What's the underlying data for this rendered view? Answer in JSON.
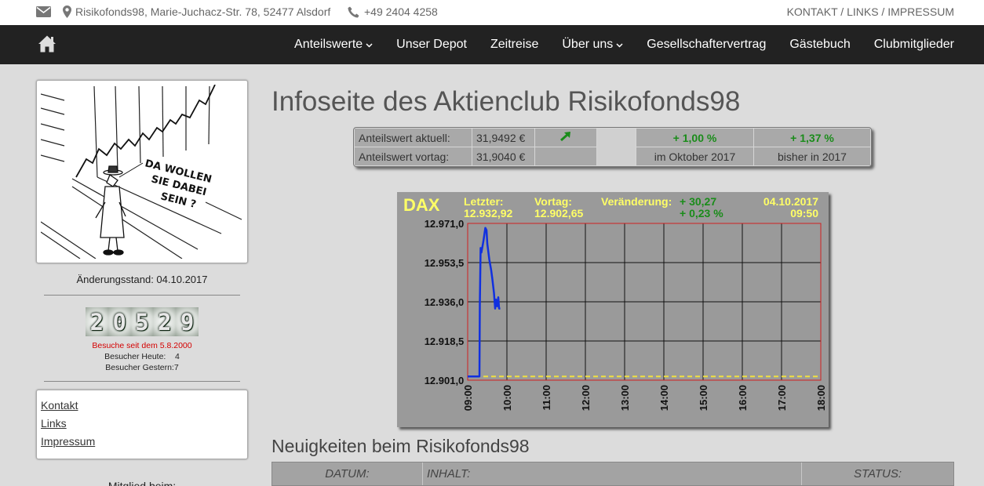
{
  "topbar": {
    "address": "Risikofonds98, Marie-Juchacz-Str. 78, 52477 Alsdorf",
    "phone": "+49 2404 4258",
    "links": "KONTAKT / LINKS / IMPRESSUM"
  },
  "nav": {
    "items": [
      {
        "label": "Anteilswerte",
        "dropdown": true
      },
      {
        "label": "Unser Depot"
      },
      {
        "label": "Zeitreise"
      },
      {
        "label": "Über uns",
        "dropdown": true
      },
      {
        "label": "Gesellschaftervertrag"
      },
      {
        "label": "Gästebuch"
      },
      {
        "label": "Clubmitglieder"
      }
    ]
  },
  "sidebar": {
    "cartoon_text": [
      "DA WOLLEN",
      "SIE DABEI",
      "SEIN ?"
    ],
    "update_label": "Änderungsstand: 04.10.2017",
    "counter_digits": [
      "2",
      "0",
      "5",
      "2",
      "9"
    ],
    "visits_since": "Besuche seit dem 5.8.2000",
    "visitors_today": "Besucher Heute:    4",
    "visitors_yesterday": "Besucher Gestern:7",
    "links": [
      "Kontakt",
      "Links",
      "Impressum"
    ],
    "member_label": "Mitglied beim:"
  },
  "main": {
    "title": "Infoseite des Aktienclub Risikofonds98",
    "quote": {
      "current_label": "Anteilswert aktuell:",
      "current_value": "31,9492 €",
      "previous_label": "Anteilswert vortag:",
      "previous_value": "31,9040 €",
      "month_change": "+ 1,00 %",
      "month_label": "im Oktober 2017",
      "year_change": "+ 1,37 %",
      "year_label": "bisher in 2017",
      "trend_icon": "arrow-up-right-icon"
    },
    "news": {
      "title": "Neuigkeiten beim Risikofonds98",
      "headers": [
        "DATUM:",
        "INHALT:",
        "STATUS:"
      ]
    }
  },
  "chart_data": {
    "type": "line",
    "title": "DAX",
    "last_label": "Letzter:",
    "last_value": "12.932,92",
    "prev_label": "Vortag:",
    "prev_value": "12.902,65",
    "change_label": "Veränderung:",
    "change_abs": "+ 30,27",
    "change_pct": "+ 0,23 %",
    "date": "04.10.2017",
    "time": "09:50",
    "x_ticks": [
      "09:00",
      "10:00",
      "11:00",
      "12:00",
      "13:00",
      "14:00",
      "15:00",
      "16:00",
      "17:00",
      "18:00"
    ],
    "y_ticks": [
      "12.971,0",
      "12.953,5",
      "12.936,0",
      "12.918,5",
      "12.901,0"
    ],
    "x_range": [
      9,
      18
    ],
    "ylim": [
      12901.0,
      12971.0
    ],
    "reference_line": 12902.65,
    "series": [
      {
        "x": [
          9.0,
          9.3,
          9.31,
          9.33,
          9.35,
          9.4,
          9.45,
          9.48,
          9.5,
          9.55,
          9.6,
          9.63,
          9.67,
          9.7,
          9.72,
          9.75,
          9.78,
          9.8,
          9.83
        ],
        "values": [
          12902.65,
          12902.65,
          12935.0,
          12960.0,
          12958.0,
          12963.0,
          12969.0,
          12968.0,
          12962.0,
          12955.0,
          12950.0,
          12946.0,
          12940.0,
          12933.0,
          12937.0,
          12934.0,
          12938.0,
          12933.0,
          12932.92
        ]
      }
    ],
    "grid": true,
    "line_color": "#1030e0",
    "reference_color": "#f0e040"
  }
}
